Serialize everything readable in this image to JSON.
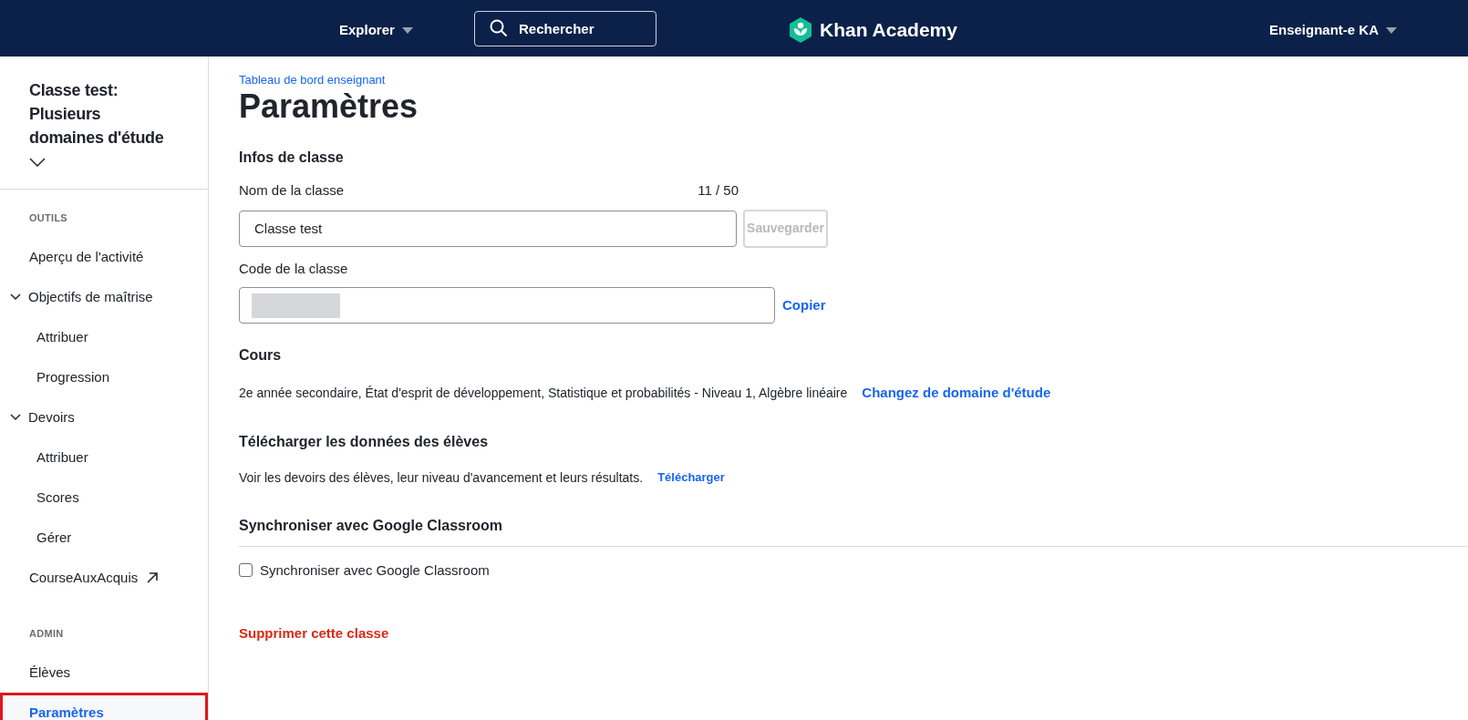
{
  "header": {
    "explore": "Explorer",
    "search": {
      "placeholder": "Rechercher"
    },
    "logo": "Khan Academy",
    "account": "Enseignant-e KA"
  },
  "sidebar": {
    "class_title": "Classe test: Plusieurs domaines d'étude",
    "sections": [
      {
        "heading": "OUTILS",
        "items": [
          {
            "label": "Aperçu de l'activité",
            "kind": "link",
            "selected": false
          },
          {
            "label": "Objectifs de maîtrise",
            "kind": "group",
            "expanded": true,
            "selected": false,
            "children": [
              {
                "label": "Attribuer",
                "selected": false
              },
              {
                "label": "Progression",
                "selected": false
              }
            ]
          },
          {
            "label": "Devoirs",
            "kind": "group",
            "expanded": true,
            "selected": false,
            "children": [
              {
                "label": "Attribuer",
                "selected": false
              },
              {
                "label": "Scores",
                "selected": false
              },
              {
                "label": "Gérer",
                "selected": false
              }
            ]
          },
          {
            "label": "CourseAuxAcquis",
            "kind": "external",
            "selected": false
          }
        ]
      },
      {
        "heading": "ADMIN",
        "items": [
          {
            "label": "Élèves",
            "kind": "link",
            "selected": false
          },
          {
            "label": "Paramètres",
            "kind": "link",
            "selected": true
          }
        ]
      }
    ]
  },
  "main": {
    "breadcrumb": "Tableau de bord enseignant",
    "title": "Paramètres",
    "class_info": {
      "heading": "Infos de classe",
      "name_label": "Nom de la classe",
      "name_count": "11 / 50",
      "name_value": "Classe test",
      "save_button": {
        "label": "Sauvegarder",
        "disabled": true
      },
      "code_label": "Code de la classe",
      "copy_link": "Copier"
    },
    "courses": {
      "heading": "Cours",
      "text": "2e année secondaire, État d'esprit de développement, Statistique et probabilités - Niveau 1, Algèbre linéaire",
      "link": "Changez de domaine d'étude"
    },
    "download": {
      "heading": "Télécharger les données des élèves",
      "text": "Voir les devoirs des élèves, leur niveau d'avancement et leurs résultats.",
      "link": "Télécharger"
    },
    "sync": {
      "heading": "Synchroniser avec Google Classroom",
      "checkbox_label": "Synchroniser avec Google Classroom",
      "checked": false
    },
    "delete_link": "Supprimer cette classe"
  }
}
